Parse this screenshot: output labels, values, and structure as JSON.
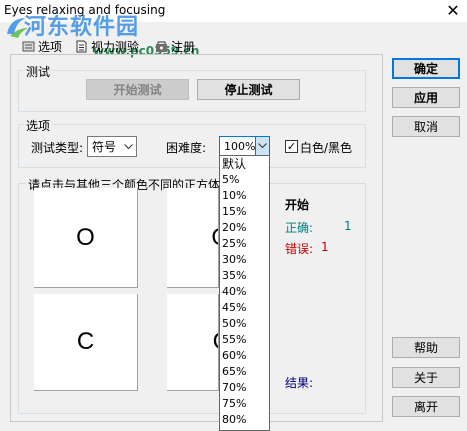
{
  "window": {
    "title": "Eyes relaxing and focusing",
    "close_glyph": "✕"
  },
  "watermark": {
    "text": "河东软件园",
    "url": "www.pc0359.cn"
  },
  "tabs": [
    {
      "label": "选项",
      "icon": "options-icon"
    },
    {
      "label": "视力测验",
      "icon": "document-icon"
    },
    {
      "label": "注册",
      "icon": "register-icon"
    }
  ],
  "test_group": {
    "label": "测试",
    "start_label": "开始测试",
    "stop_label": "停止测试"
  },
  "options_group": {
    "label": "选项",
    "test_type_label": "测试类型:",
    "test_type_value": "符号",
    "difficulty_label": "困难度:",
    "difficulty_value": "100%",
    "bw_label": "白色/黑色",
    "bw_checked": true
  },
  "instruction": "请点击与其他三个颜色不同的正方体",
  "grid": {
    "cells": [
      "O",
      "O",
      "C",
      "C"
    ]
  },
  "stats": {
    "start_label": "开始",
    "correct_label": "正确:",
    "correct_value": "1",
    "wrong_label": "错误:",
    "wrong_value": "1",
    "result_label": "结果:"
  },
  "right_buttons": {
    "ok": "确定",
    "apply": "应用",
    "cancel": "取消",
    "help": "帮助",
    "about": "关于",
    "exit": "离开"
  },
  "difficulty_options": [
    "默认",
    "5%",
    "10%",
    "15%",
    "20%",
    "25%",
    "30%",
    "35%",
    "40%",
    "45%",
    "50%",
    "55%",
    "60%",
    "65%",
    "70%",
    "75%",
    "80%"
  ],
  "colors": {
    "accent": "#0078d7",
    "correct": "#008080",
    "wrong": "#cc0000",
    "result": "#000080",
    "start": "#000000"
  }
}
